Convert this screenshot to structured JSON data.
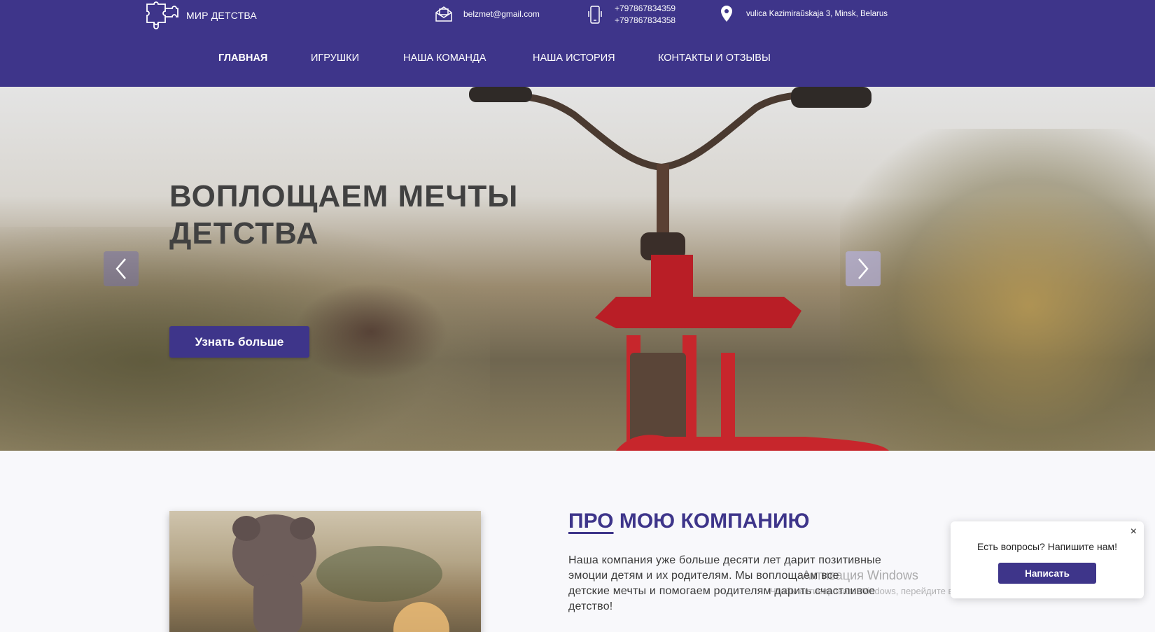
{
  "header": {
    "brand": "МИР ДЕТСТВА",
    "email": "belzmet@gmail.com",
    "phones": [
      "+797867834359",
      "+797867834358"
    ],
    "address": "vulica Kazimiraŭskaja 3, Minsk, Belarus",
    "icons": {
      "logo": "puzzle-logo-icon",
      "email": "envelope-icon",
      "phone": "phone-icon",
      "address": "location-pin-icon"
    }
  },
  "nav": {
    "items": [
      {
        "label": "ГЛАВНАЯ",
        "active": true
      },
      {
        "label": "ИГРУШКИ",
        "active": false
      },
      {
        "label": "НАША КОМАНДА",
        "active": false
      },
      {
        "label": "НАША ИСТОРИЯ",
        "active": false
      },
      {
        "label": "КОНТАКТЫ И ОТЗЫВЫ",
        "active": false
      }
    ]
  },
  "hero": {
    "title_line1": "ВОПЛОЩАЕМ МЕЧТЫ",
    "title_line2": "ДЕТСТВА",
    "button": "Узнать больше"
  },
  "about": {
    "title_underlined": "ПРО",
    "title_rest": " МОЮ КОМПАНИЮ",
    "text": "Наша компания уже больше десяти лет дарит позитивные эмоции детям и их родителям. Мы воплощаем все детские мечты и помогаем родителям дарить счастливое детство!"
  },
  "watermark": {
    "line1": "Активация Windows",
    "line2": "Чтобы активировать Windows, перейдите в раздел \"Параметры\"."
  },
  "chat": {
    "close": "×",
    "question": "Есть вопросы? Напишите нам!",
    "button": "Написать"
  },
  "colors": {
    "brand": "#3e358a",
    "hero_title": "#414141"
  }
}
